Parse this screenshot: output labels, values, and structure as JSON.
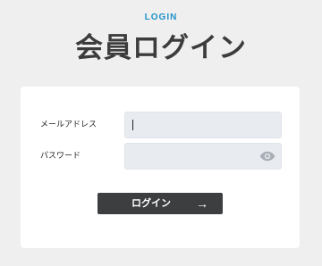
{
  "header": {
    "eyebrow": "LOGIN",
    "title": "会員ログイン"
  },
  "form": {
    "email": {
      "label": "メールアドレス",
      "value": ""
    },
    "password": {
      "label": "パスワード",
      "value": "",
      "toggle_icon": "eye-icon"
    },
    "submit": {
      "label": "ログイン",
      "icon": "arrow-right-icon",
      "arrow_glyph": "→"
    }
  },
  "colors": {
    "background": "#efefef",
    "accent": "#1e93c8",
    "title": "#3c3c3c",
    "card": "#ffffff",
    "field": "#e8ebf0",
    "button": "#3d3e40",
    "icon": "#a9aeb6"
  }
}
